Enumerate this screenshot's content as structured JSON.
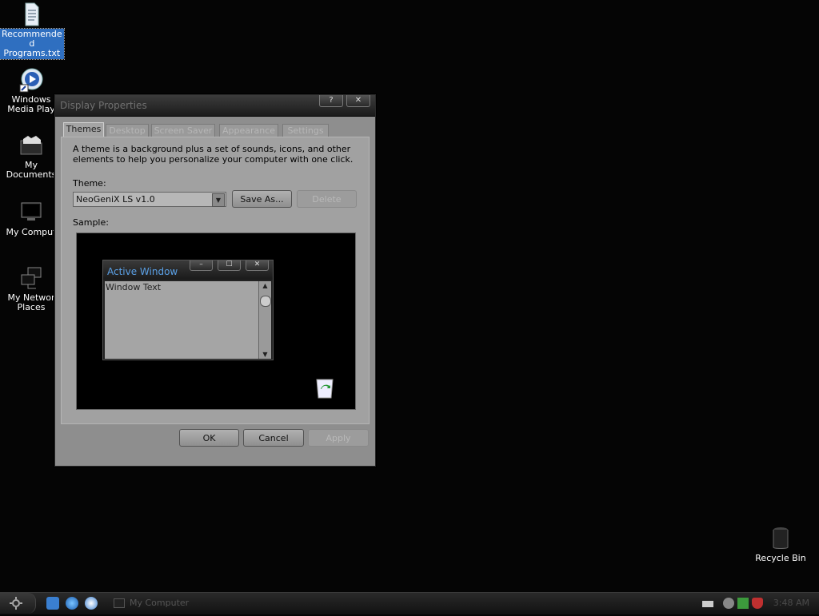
{
  "desktop": {
    "icons": [
      {
        "label": "Recommende\nd\nPrograms.txt",
        "icon": "text-file-icon",
        "selected": true
      },
      {
        "label": "Windows\nMedia Play",
        "icon": "media-player-icon"
      },
      {
        "label": "My\nDocuments",
        "icon": "documents-folder-icon"
      },
      {
        "label": "My Comput",
        "icon": "computer-icon"
      },
      {
        "label": "My Networ\nPlaces",
        "icon": "network-icon"
      },
      {
        "label": "Recycle Bin",
        "icon": "recycle-bin-icon"
      }
    ]
  },
  "dialog": {
    "title": "Display Properties",
    "help_label": "?",
    "close_label": "✕",
    "tabs": [
      {
        "label": "Themes",
        "active": true
      },
      {
        "label": "Desktop"
      },
      {
        "label": "Screen Saver"
      },
      {
        "label": "Appearance"
      },
      {
        "label": "Settings"
      }
    ],
    "description": "A theme is a background plus a set of sounds, icons, and other elements to help you personalize your computer with one click.",
    "theme_label": "Theme:",
    "theme_value": "NeoGeniX LS v1.0",
    "save_as_label": "Save As...",
    "delete_label": "Delete",
    "sample_label": "Sample:",
    "sample": {
      "window_title": "Active Window",
      "window_text": "Window Text",
      "min_label": "–",
      "max_label": "☐",
      "close_label": "✕"
    },
    "ok_label": "OK",
    "cancel_label": "Cancel",
    "apply_label": "Apply"
  },
  "taskbar": {
    "task_label": "My Computer",
    "clock": "3:48 AM"
  },
  "colors": {
    "desktop": "#050505",
    "dialog_face": "#8e8e8e",
    "accent_title": "#5aa0e6",
    "selection": "#2f6fc0"
  }
}
